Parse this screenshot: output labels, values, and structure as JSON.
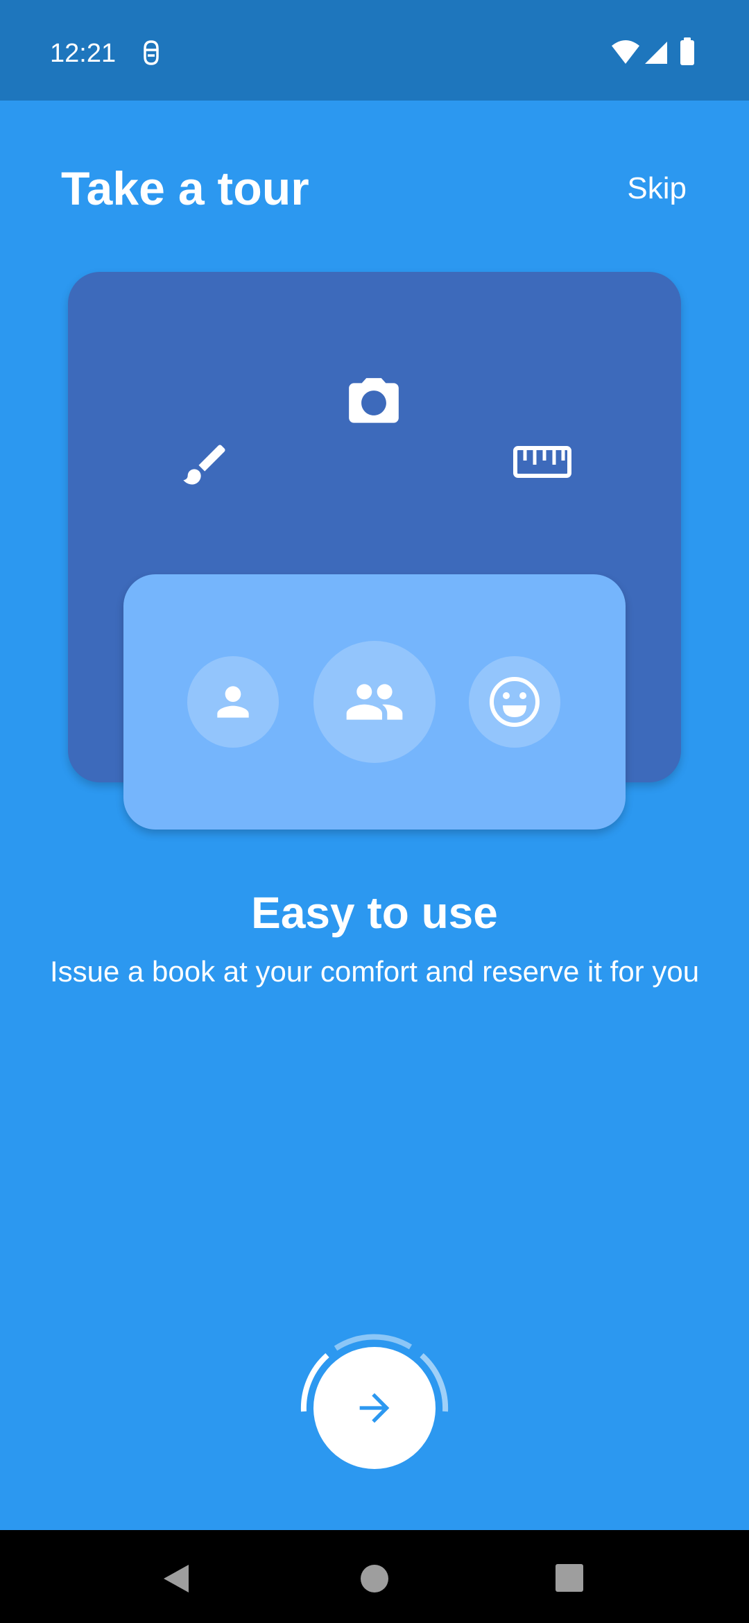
{
  "status_bar": {
    "time": "12:21",
    "icons": [
      "dev-app-icon",
      "wifi-icon",
      "signal-icon",
      "battery-icon"
    ]
  },
  "header": {
    "title": "Take a tour",
    "skip_label": "Skip"
  },
  "illustration": {
    "back_card_icons": [
      "paintbrush-icon",
      "camera-icon",
      "ruler-icon"
    ],
    "front_card_icons": [
      "person-icon",
      "group-icon",
      "smiley-icon"
    ]
  },
  "slide": {
    "title": "Easy to use",
    "description": "Issue a book at your comfort and reserve it for you"
  },
  "navigation": {
    "next_icon": "arrow-right-icon"
  },
  "system_nav": {
    "buttons": [
      "back-icon",
      "home-icon",
      "recents-icon"
    ]
  },
  "colors": {
    "background": "#2c98f0",
    "status_bar": "#1e76bd",
    "back_card": "#3d6abb",
    "front_card": "#75b5fc",
    "accent": "#2c98f0"
  }
}
